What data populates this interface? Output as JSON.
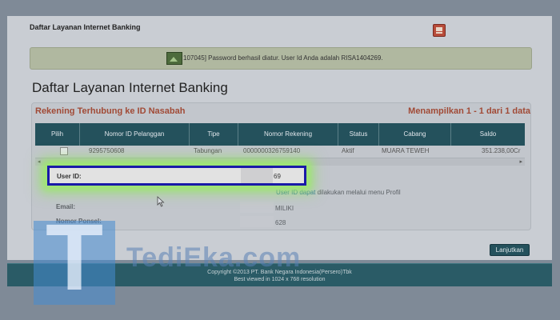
{
  "header": {
    "title": "Daftar Layanan Internet Banking",
    "print_icon": "printer-icon"
  },
  "alert": {
    "icon": "image-icon",
    "message": "107045] Password berhasil diatur. User Id Anda adalah RISA1404269."
  },
  "page_title": "Daftar Layanan Internet Banking",
  "panel": {
    "heading": "Rekening Terhubung ke ID Nasabah",
    "count": "Menampilkan 1 - 1 dari 1 data",
    "columns": [
      "Pilih",
      "Nomor ID Pelanggan",
      "Tipe",
      "Nomor Rekening",
      "Status",
      "Cabang",
      "Saldo"
    ],
    "row": {
      "pelanggan": "9295750608",
      "tipe": "Tabungan",
      "rekening": "0000000326759140",
      "status": "Aktif",
      "cabang": "MUARA TEWEH",
      "saldo": "351.238,00Cr"
    },
    "scroll_left": "◂",
    "scroll_right": "▸"
  },
  "user_info": {
    "user_id_label": "User ID:",
    "user_id_value": "69",
    "note_link": "User ID dapat",
    "note_rest": "dilakukan melalui menu Profil",
    "email_label": "Email:",
    "email_value": "MILIKI",
    "phone_label": "Nomor Ponsel:",
    "phone_value": "628"
  },
  "continue_label": "Lanjutkan",
  "footer": {
    "line1": "Copyright ©2013 PT. Bank Negara Indonesia(Persero)Tbk",
    "line2": "Best viewed in 1024 x 768 resolution"
  },
  "watermark": {
    "letter": "T",
    "text": "TediEka.com"
  }
}
